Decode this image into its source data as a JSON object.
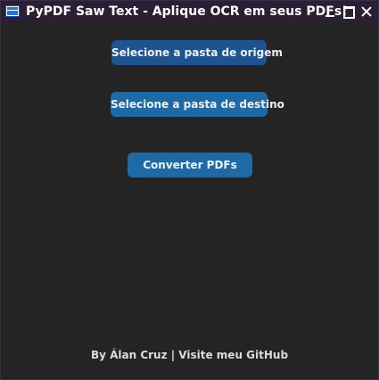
{
  "window": {
    "title": "PyPDF Saw Text - Aplique OCR em seus PDFs!",
    "icon": "window-app-icon",
    "controls": {
      "minimize": "minimize-icon",
      "maximize": "maximize-icon",
      "close": "close-icon"
    }
  },
  "actions": {
    "select_source": "Selecione a pasta de origem",
    "select_destination": "Selecione a pasta de destino",
    "convert": "Converter PDFs"
  },
  "footer": {
    "credit": "By Álan Cruz | Visite meu GitHub"
  },
  "colors": {
    "background": "#242424",
    "titlebar": "#2a1f34",
    "button_hover": "#1f538d",
    "button": "#1f6aa5",
    "text": "#ffffff"
  }
}
